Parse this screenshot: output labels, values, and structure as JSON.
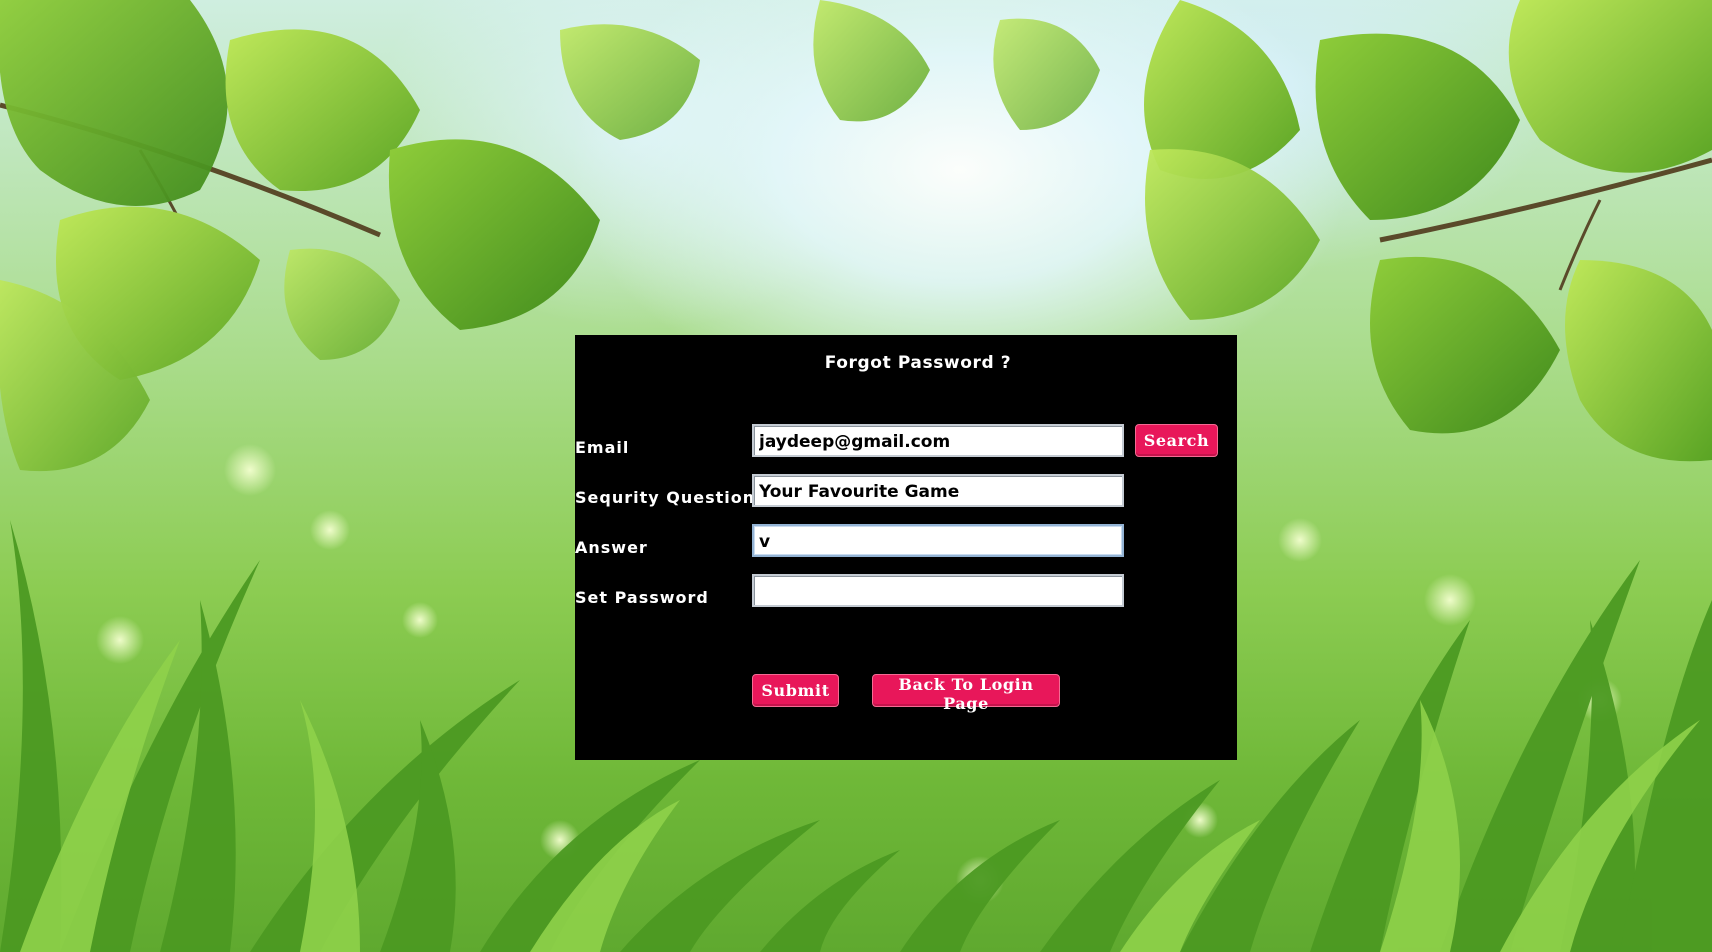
{
  "form": {
    "title": "Forgot Password  ?",
    "email": {
      "label": "Email",
      "value": "jaydeep@gmail.com"
    },
    "security_question": {
      "label": "Sequrity Question",
      "value": "Your Favourite Game"
    },
    "answer": {
      "label": "Answer",
      "value": "v"
    },
    "set_password": {
      "label": "Set Password",
      "value": ""
    },
    "buttons": {
      "search": "Search",
      "submit": "Submit",
      "back": "Back To Login Page"
    }
  },
  "colors": {
    "panel_background": "#000000",
    "button_background": "#e8175a",
    "text": "#ffffff"
  }
}
